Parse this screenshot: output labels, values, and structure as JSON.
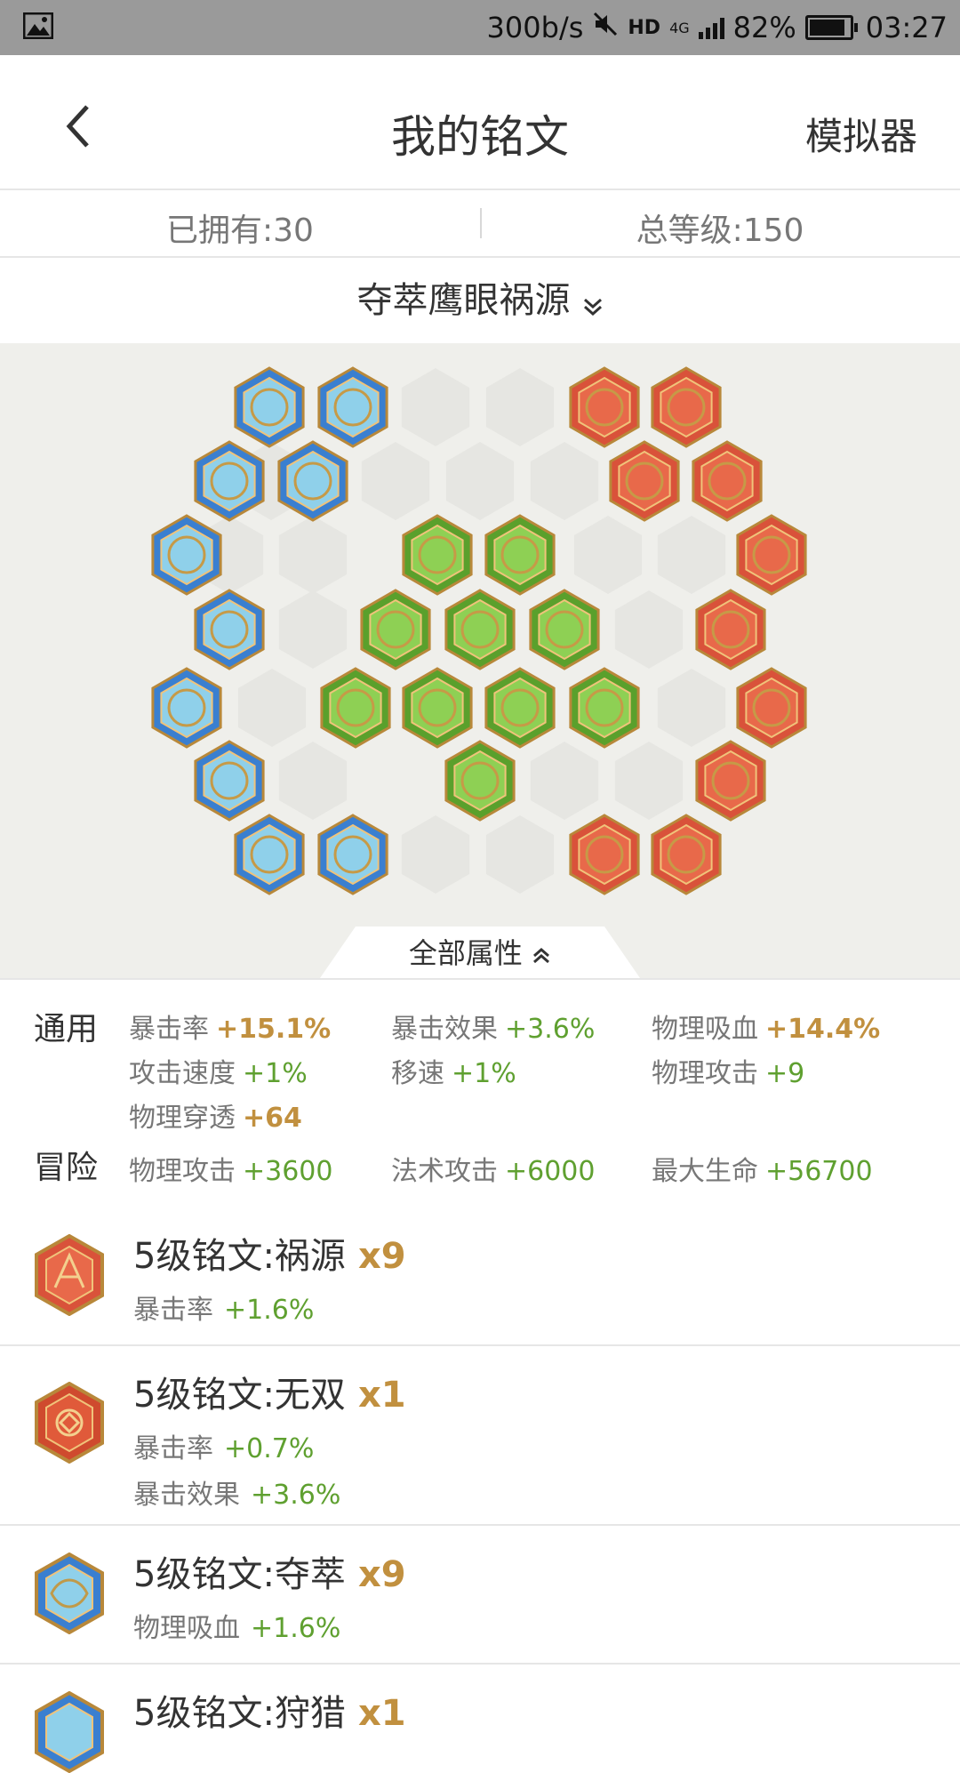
{
  "status_bar": {
    "speed": "300b/s",
    "network": "4G",
    "hd": "HD",
    "battery": "82%",
    "time": "03:27"
  },
  "header": {
    "title": "我的铭文",
    "simulator": "模拟器"
  },
  "stats": {
    "owned": "已拥有:30",
    "total_level": "总等级:150"
  },
  "set_name": "夺萃鹰眼祸源",
  "toggle_label": "全部属性",
  "attributes": {
    "general_label": "通用",
    "adventure_label": "冒险",
    "general": [
      {
        "name": "暴击率",
        "value": "+15.1%"
      },
      {
        "name": "暴击效果",
        "value": "+3.6%"
      },
      {
        "name": "物理吸血",
        "value": "+14.4%"
      },
      {
        "name": "攻击速度",
        "value": "+1%"
      },
      {
        "name": "移速",
        "value": "+1%"
      },
      {
        "name": "物理攻击",
        "value": "+9"
      },
      {
        "name": "物理穿透",
        "value": "+64"
      }
    ],
    "adventure": [
      {
        "name": "物理攻击",
        "value": "+3600"
      },
      {
        "name": "法术攻击",
        "value": "+6000"
      },
      {
        "name": "最大生命",
        "value": "+56700"
      }
    ]
  },
  "inscriptions": [
    {
      "title": "5级铭文:祸源",
      "count": "x9",
      "stats": [
        {
          "name": "暴击率",
          "value": "+1.6%"
        }
      ]
    },
    {
      "title": "5级铭文:无双",
      "count": "x1",
      "stats": [
        {
          "name": "暴击率",
          "value": "+0.7%"
        },
        {
          "name": "暴击效果",
          "value": "+3.6%"
        }
      ]
    },
    {
      "title": "5级铭文:夺萃",
      "count": "x9",
      "stats": [
        {
          "name": "物理吸血",
          "value": "+1.6%"
        }
      ]
    },
    {
      "title": "5级铭文:狩猎",
      "count": "x1",
      "stats": []
    }
  ],
  "colors": {
    "gold": "#c1903f",
    "green": "#5fa030",
    "blue_gem": "#3a7fd0",
    "red_gem": "#d9523a",
    "green_gem": "#5aa02c"
  }
}
